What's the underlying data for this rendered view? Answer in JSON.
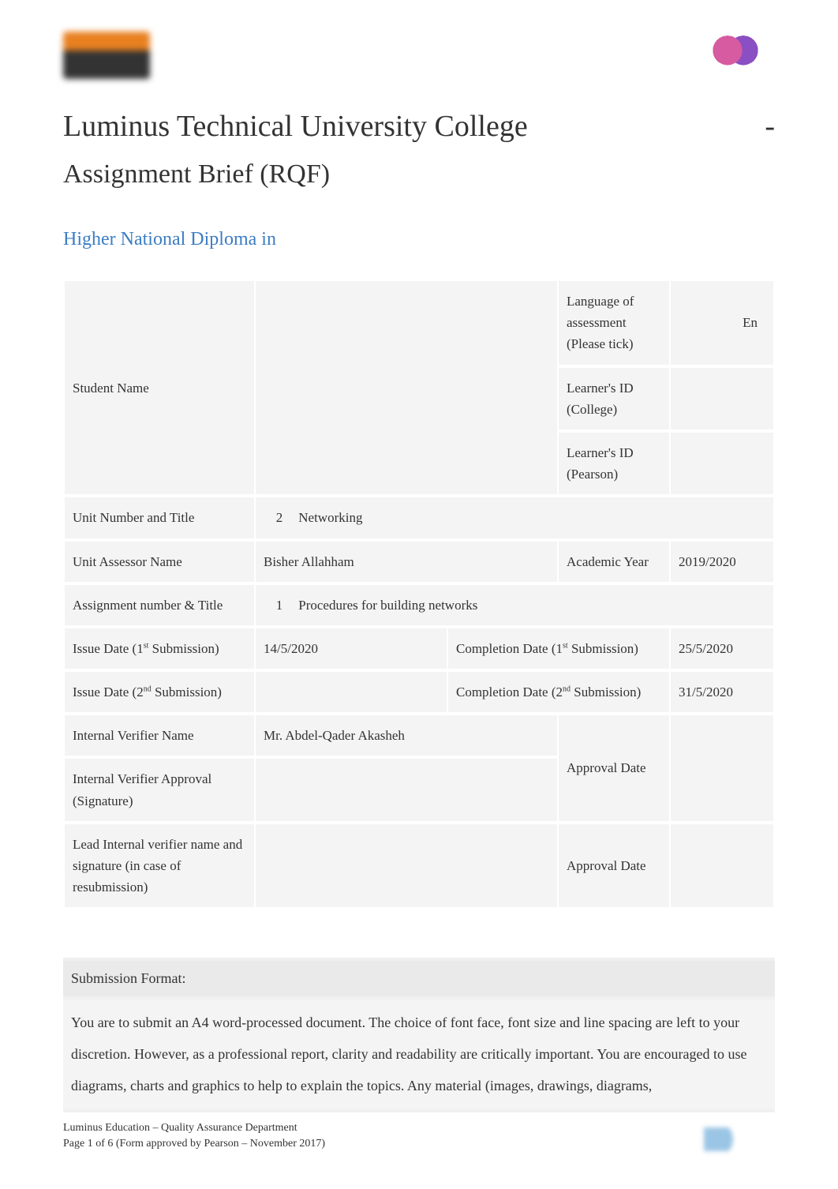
{
  "header": {
    "title": "Luminus Technical University College",
    "dash": "-",
    "subtitle": "Assignment Brief (RQF)",
    "diploma_line": "Higher National Diploma in"
  },
  "table": {
    "student_name_label": "Student Name",
    "language_label": "Language of assessment (Please tick)",
    "language_value": "En",
    "learner_id_college_label": "Learner's ID (College)",
    "learner_id_pearson_label": "Learner's ID (Pearson)",
    "unit_number_title_label": "Unit Number and Title",
    "unit_number": "2",
    "unit_title": "Networking",
    "unit_assessor_label": "Unit Assessor Name",
    "unit_assessor_value": "Bisher Allahham",
    "academic_year_label": "Academic Year",
    "academic_year_value": "2019/2020",
    "assignment_number_label": "Assignment number & Title",
    "assignment_number": "1",
    "assignment_title": "Procedures for building networks",
    "issue_date_1_label_part1": "Issue Date (1",
    "issue_date_1_label_sup": "st",
    "issue_date_1_label_part2": " Submission)",
    "issue_date_1_value": "14/5/2020",
    "completion_date_1_label_part1": "Completion Date (1",
    "completion_date_1_label_sup": "st",
    "completion_date_1_label_part2": " Submission)",
    "completion_date_1_value": "25/5/2020",
    "issue_date_2_label_part1": "Issue Date (2",
    "issue_date_2_label_sup": "nd",
    "issue_date_2_label_part2": " Submission)",
    "completion_date_2_label_part1": "Completion Date (2",
    "completion_date_2_label_sup": "nd",
    "completion_date_2_label_part2": " Submission)",
    "completion_date_2_value": "31/5/2020",
    "internal_verifier_label": "Internal Verifier Name",
    "internal_verifier_value": "Mr. Abdel-Qader Akasheh",
    "internal_verifier_approval_label": "Internal Verifier Approval (Signature)",
    "approval_date_label": "Approval Date",
    "lead_verifier_label": "Lead Internal verifier name and signature        (in case of resubmission)",
    "approval_date_label2": "Approval Date"
  },
  "submission": {
    "header": "Submission Format:",
    "body": "You are to submit an A4 word-processed document. The choice of font face, font size and line spacing are left to your discretion. However, as a professional report, clarity and readability are critically important. You are encouraged to use diagrams, charts and graphics to help to explain the topics. Any material (images, drawings, diagrams,"
  },
  "footer": {
    "line1": "Luminus Education – Quality Assurance Department",
    "line2": "Page 1 of 6 (Form approved by Pearson – November 2017)"
  }
}
